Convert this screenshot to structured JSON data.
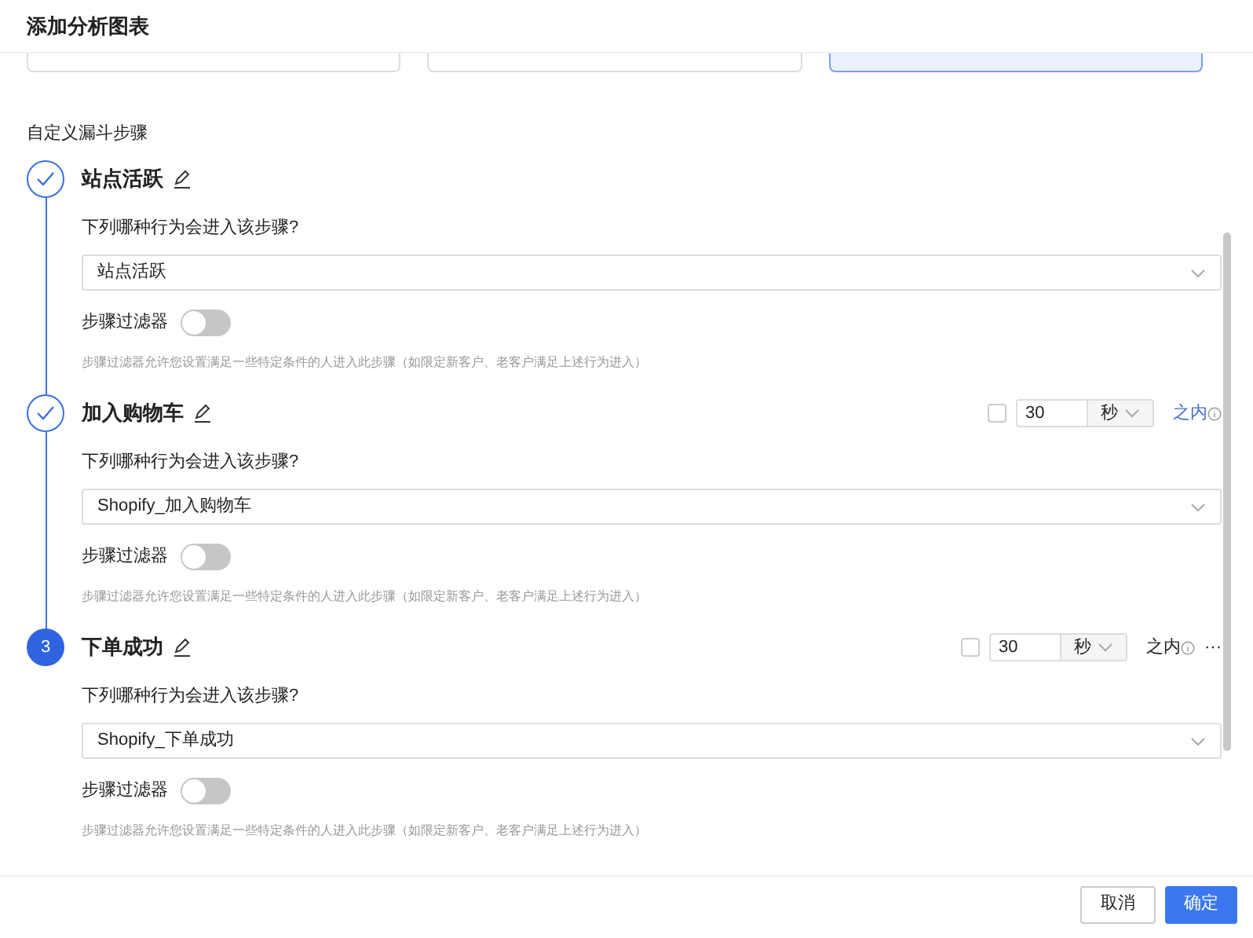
{
  "dialog": {
    "title": "添加分析图表"
  },
  "cards": [
    {
      "selected": false
    },
    {
      "selected": false
    },
    {
      "selected": true
    }
  ],
  "section_label": "自定义漏斗步骤",
  "steps": [
    {
      "completed": true,
      "title": "站点活跃",
      "question": "下列哪种行为会进入该步骤?",
      "event": "站点活跃",
      "filter_label": "步骤过滤器",
      "filter_on": false,
      "hint": "步骤过滤器允许您设置满足一些特定条件的人进入此步骤（如限定新客户、老客户满足上述行为进入）"
    },
    {
      "completed": true,
      "title": "加入购物车",
      "window": {
        "checked": false,
        "value": "30",
        "unit": "秒",
        "suffix": "之内",
        "highlighted": true
      },
      "question": "下列哪种行为会进入该步骤?",
      "event": "Shopify_加入购物车",
      "filter_label": "步骤过滤器",
      "filter_on": false,
      "hint": "步骤过滤器允许您设置满足一些特定条件的人进入此步骤（如限定新客户、老客户满足上述行为进入）"
    },
    {
      "completed": false,
      "number": "3",
      "title": "下单成功",
      "window": {
        "checked": false,
        "value": "30",
        "unit": "秒",
        "suffix": "之内",
        "highlighted": false,
        "more": "···"
      },
      "question": "下列哪种行为会进入该步骤?",
      "event": "Shopify_下单成功",
      "filter_label": "步骤过滤器",
      "filter_on": false,
      "hint": "步骤过滤器允许您设置满足一些特定条件的人进入此步骤（如限定新客户、老客户满足上述行为进入）"
    }
  ],
  "buttons": [
    {
      "label": "取消",
      "kind": "secondary"
    },
    {
      "label": "确定",
      "kind": "primary"
    }
  ]
}
